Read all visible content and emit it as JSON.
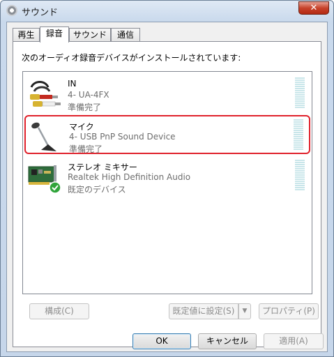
{
  "window": {
    "title": "サウンド",
    "close_label": "✕"
  },
  "tabs": [
    {
      "label": "再生"
    },
    {
      "label": "録音"
    },
    {
      "label": "サウンド"
    },
    {
      "label": "通信"
    }
  ],
  "instruction": "次のオーディオ録音デバイスがインストールされています:",
  "devices": [
    {
      "name": "IN",
      "sub": "4- UA-4FX",
      "status": "準備完了",
      "icon": "rca-cable-icon"
    },
    {
      "name": "マイク",
      "sub": "4- USB PnP Sound Device",
      "status": "準備完了",
      "icon": "microphone-icon"
    },
    {
      "name": "ステレオ ミキサー",
      "sub": "Realtek High Definition Audio",
      "status": "既定のデバイス",
      "icon": "sound-card-default-icon"
    }
  ],
  "buttons": {
    "configure": "構成(C)",
    "set_default": "既定値に設定(S)",
    "properties": "プロパティ(P)",
    "ok": "OK",
    "cancel": "キャンセル",
    "apply": "適用(A)"
  },
  "colors": {
    "selection_outline": "#e0212b",
    "meter": "#c9e6ea"
  }
}
